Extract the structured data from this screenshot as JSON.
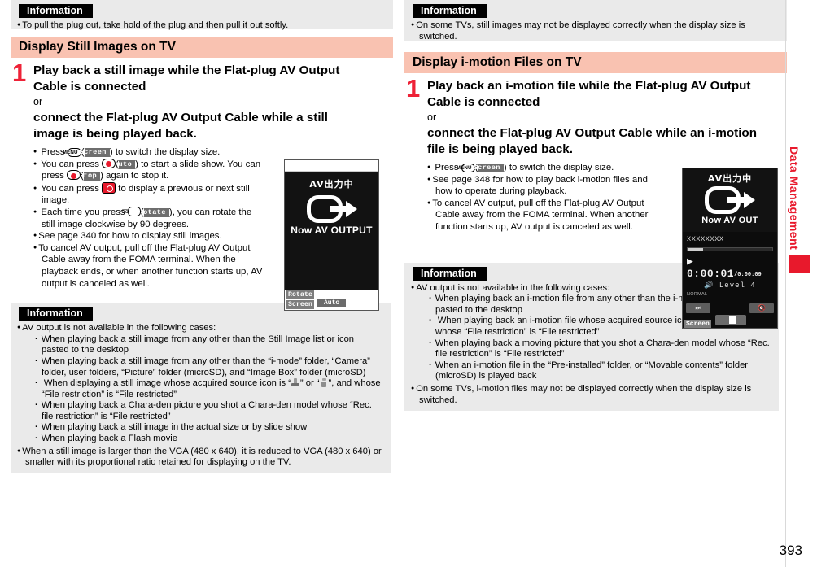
{
  "page_number": "393",
  "side_tab": {
    "label": "Data Management"
  },
  "left": {
    "info_top": {
      "title": "Information",
      "items": [
        {
          "type": "bullet",
          "text": "To pull the plug out, take hold of the plug and then pull it out softly."
        }
      ]
    },
    "section": {
      "title": "Display Still Images on TV"
    },
    "step": {
      "number": "1",
      "line1": "Play back a still image while the Flat-plug AV Output Cable is connected",
      "or": "or",
      "line2": "connect the Flat-plug AV Output Cable while a still image is being played back."
    },
    "bullets": [
      {
        "id": "press-screen",
        "pre": "Press ",
        "key": "MENU",
        "mid": "(",
        "soft": "Screen",
        "post": ") to switch the display size."
      },
      {
        "id": "slide-show",
        "pre": "You can press ",
        "key": "red-select",
        "mid": "(",
        "soft": "Auto",
        "post": ") to start a slide show. You can press ",
        "key2": "red-select",
        "soft2": "Stop",
        "post2": ") again to stop it."
      },
      {
        "id": "prev-next",
        "pre": "You can press ",
        "key": "dpad",
        "post": " to display a previous or next still image."
      },
      {
        "id": "rotate",
        "pre": "Each time you press ",
        "key": "mail",
        "mid": "(",
        "soft": "Rotate",
        "post": "), you can rotate the still image clockwise by 90 degrees."
      },
      {
        "id": "see-page",
        "text": "See page 340 for how to display still images."
      },
      {
        "id": "cancel-av",
        "text": "To cancel AV output, pull off the Flat-plug AV Output Cable away from the FOMA terminal. When the playback ends, or when another function starts up, AV output is canceled as well."
      }
    ],
    "phone_screen": {
      "jp_text": "AV出力中",
      "en_text": "Now AV OUTPUT",
      "soft_top": "Rotate",
      "soft_bottom": "Screen",
      "soft_center": "Auto"
    },
    "info_bottom": {
      "title": "Information",
      "items": [
        {
          "type": "bullet",
          "text": "AV output is not available in the following cases:"
        },
        {
          "type": "sub",
          "text": "When playing back a still image from any other than the Still Image list or icon pasted to the desktop"
        },
        {
          "type": "sub",
          "text": "When playing back a still image from any other than the “i-mode” folder, “Camera” folder, user folders, “Picture” folder (microSD), and “Image Box” folder (microSD)"
        },
        {
          "type": "sub-icons",
          "pre": "When displaying a still image whose acquired source icon is “",
          "mid": "” or “",
          "post": "”, and whose “File restriction” is “File restricted”"
        },
        {
          "type": "sub",
          "text": "When playing back a Chara-den picture you shot a Chara-den model whose “Rec. file restriction” is “File restricted”"
        },
        {
          "type": "sub",
          "text": "When playing back a still image in the actual size or by slide show"
        },
        {
          "type": "sub",
          "text": "When playing back a Flash movie"
        },
        {
          "type": "bullet",
          "text": "When a still image is larger than the VGA (480 x 640), it is reduced to VGA (480 x 640) or smaller with its proportional ratio retained for displaying on the TV."
        }
      ]
    }
  },
  "right": {
    "info_top": {
      "title": "Information",
      "items": [
        {
          "type": "bullet",
          "text": "On some TVs, still images may not be displayed correctly when the display size is switched."
        }
      ]
    },
    "section": {
      "title": "Display i-motion Files on TV"
    },
    "step": {
      "number": "1",
      "line1": "Play back an i-motion file while the Flat-plug AV Output Cable is connected",
      "or": "or",
      "line2": "connect the Flat-plug AV Output Cable while an i-motion file is being played back."
    },
    "bullets": [
      {
        "id": "press-screen",
        "pre": "Press ",
        "key": "MENU",
        "mid": "(",
        "soft": "Screen",
        "post": ") to switch the display size."
      },
      {
        "id": "see-page",
        "text": "See page 348 for how to play back i-motion files and how to operate during playback."
      },
      {
        "id": "cancel-av",
        "text": "To cancel AV output, pull off the Flat-plug AV Output Cable away from the FOMA terminal. When another function starts up, AV output is canceled as well."
      }
    ],
    "phone_screen": {
      "jp_text": "AV出力中",
      "en_text": "Now AV OUT",
      "file_name": "XXXXXXXX",
      "time_current": "0:00:01",
      "time_total": "/0:00:09",
      "volume_label": "Level  4",
      "mode_label": "NORMAL",
      "soft_screen": "Screen"
    },
    "info_bottom": {
      "title": "Information",
      "items": [
        {
          "type": "bullet",
          "text": "AV output is not available in the following cases:"
        },
        {
          "type": "sub",
          "text": "When playing back an i-motion file from any other than the i-motion list or icon pasted to the desktop"
        },
        {
          "type": "sub-icons",
          "pre": "When playing back an i-motion file whose acquired source icon is “",
          "mid": "” or “",
          "post": "”, and whose “File restriction” is “File restricted”"
        },
        {
          "type": "sub",
          "text": "When playing back a moving picture that you shot a Chara-den model whose “Rec. file restriction” is “File restricted”"
        },
        {
          "type": "sub",
          "text": "When an i-motion file in the “Pre-installed” folder, or “Movable contents” folder (microSD) is played back"
        },
        {
          "type": "bullet",
          "text": "On some TVs, i-motion files may not be displayed correctly when the display size is switched."
        }
      ]
    }
  }
}
